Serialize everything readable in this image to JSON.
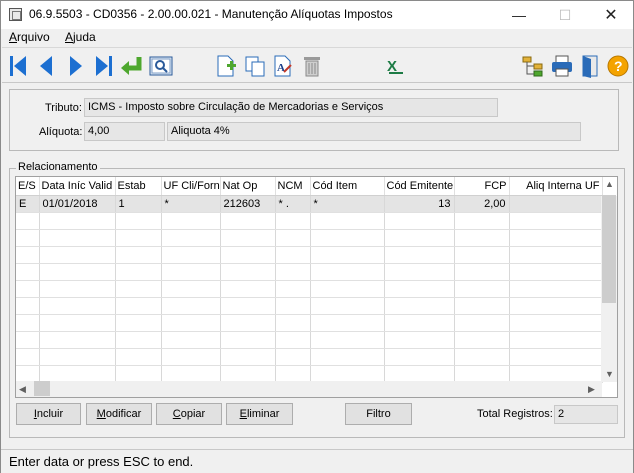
{
  "window": {
    "title": "06.9.5503 - CD0356 - 2.00.00.021 - Manutenção Alíquotas Impostos",
    "minimize": "—",
    "maximize": "☐",
    "close": "✕"
  },
  "menu": [
    {
      "label": "Arquivo",
      "mnemonic": "A",
      "rest": "rquivo"
    },
    {
      "label": "Ajuda",
      "mnemonic": "A",
      "rest": "juda"
    }
  ],
  "toolbar": {
    "icons": [
      "first-icon",
      "previous-icon",
      "next-icon",
      "last-icon",
      "goto-icon",
      "search-icon",
      "new-icon",
      "copy-icon",
      "edit-icon",
      "delete-icon",
      "excel-icon",
      "tree-icon",
      "print-icon",
      "exit-icon",
      "help-icon"
    ],
    "colors": {
      "nav": "#1c6fd1",
      "goto": "#4ea72e",
      "excel": "#1d7b45",
      "help": "#f4a300"
    }
  },
  "tributo": {
    "label": "Tributo:",
    "value": "ICMS - Imposto sobre Circulação de Mercadorias e Serviços"
  },
  "aliquota": {
    "label": "Alíquota:",
    "code": "4,00",
    "description": "Aliquota 4%"
  },
  "relacionamento": {
    "title": "Relacionamento",
    "columns": [
      "E/S",
      "Data Iníc Valid",
      "Estab",
      "UF Cli/Forn",
      "Nat Op",
      "NCM",
      "Cód Item",
      "Cód Emitente",
      "FCP",
      "Aliq Interna UF"
    ],
    "rows": [
      [
        "E",
        "01/01/2018",
        "1",
        "*",
        "212603",
        "* .",
        "*",
        "13",
        "2,00",
        ""
      ]
    ]
  },
  "buttons": {
    "incluir": {
      "label": "Incluir",
      "mnemonic": "I",
      "rest": "ncluir"
    },
    "modificar": {
      "label": "Modificar",
      "mnemonic": "M",
      "rest": "odificar"
    },
    "copiar": {
      "label": "Copiar",
      "mnemonic": "C",
      "rest": "opiar"
    },
    "eliminar": {
      "label": "Eliminar",
      "mnemonic": "E",
      "rest": "liminar"
    },
    "filtro": {
      "label": "Filtro"
    }
  },
  "total": {
    "label": "Total Registros:",
    "value": "2"
  },
  "status": {
    "text": "Enter data or press ESC to end."
  }
}
